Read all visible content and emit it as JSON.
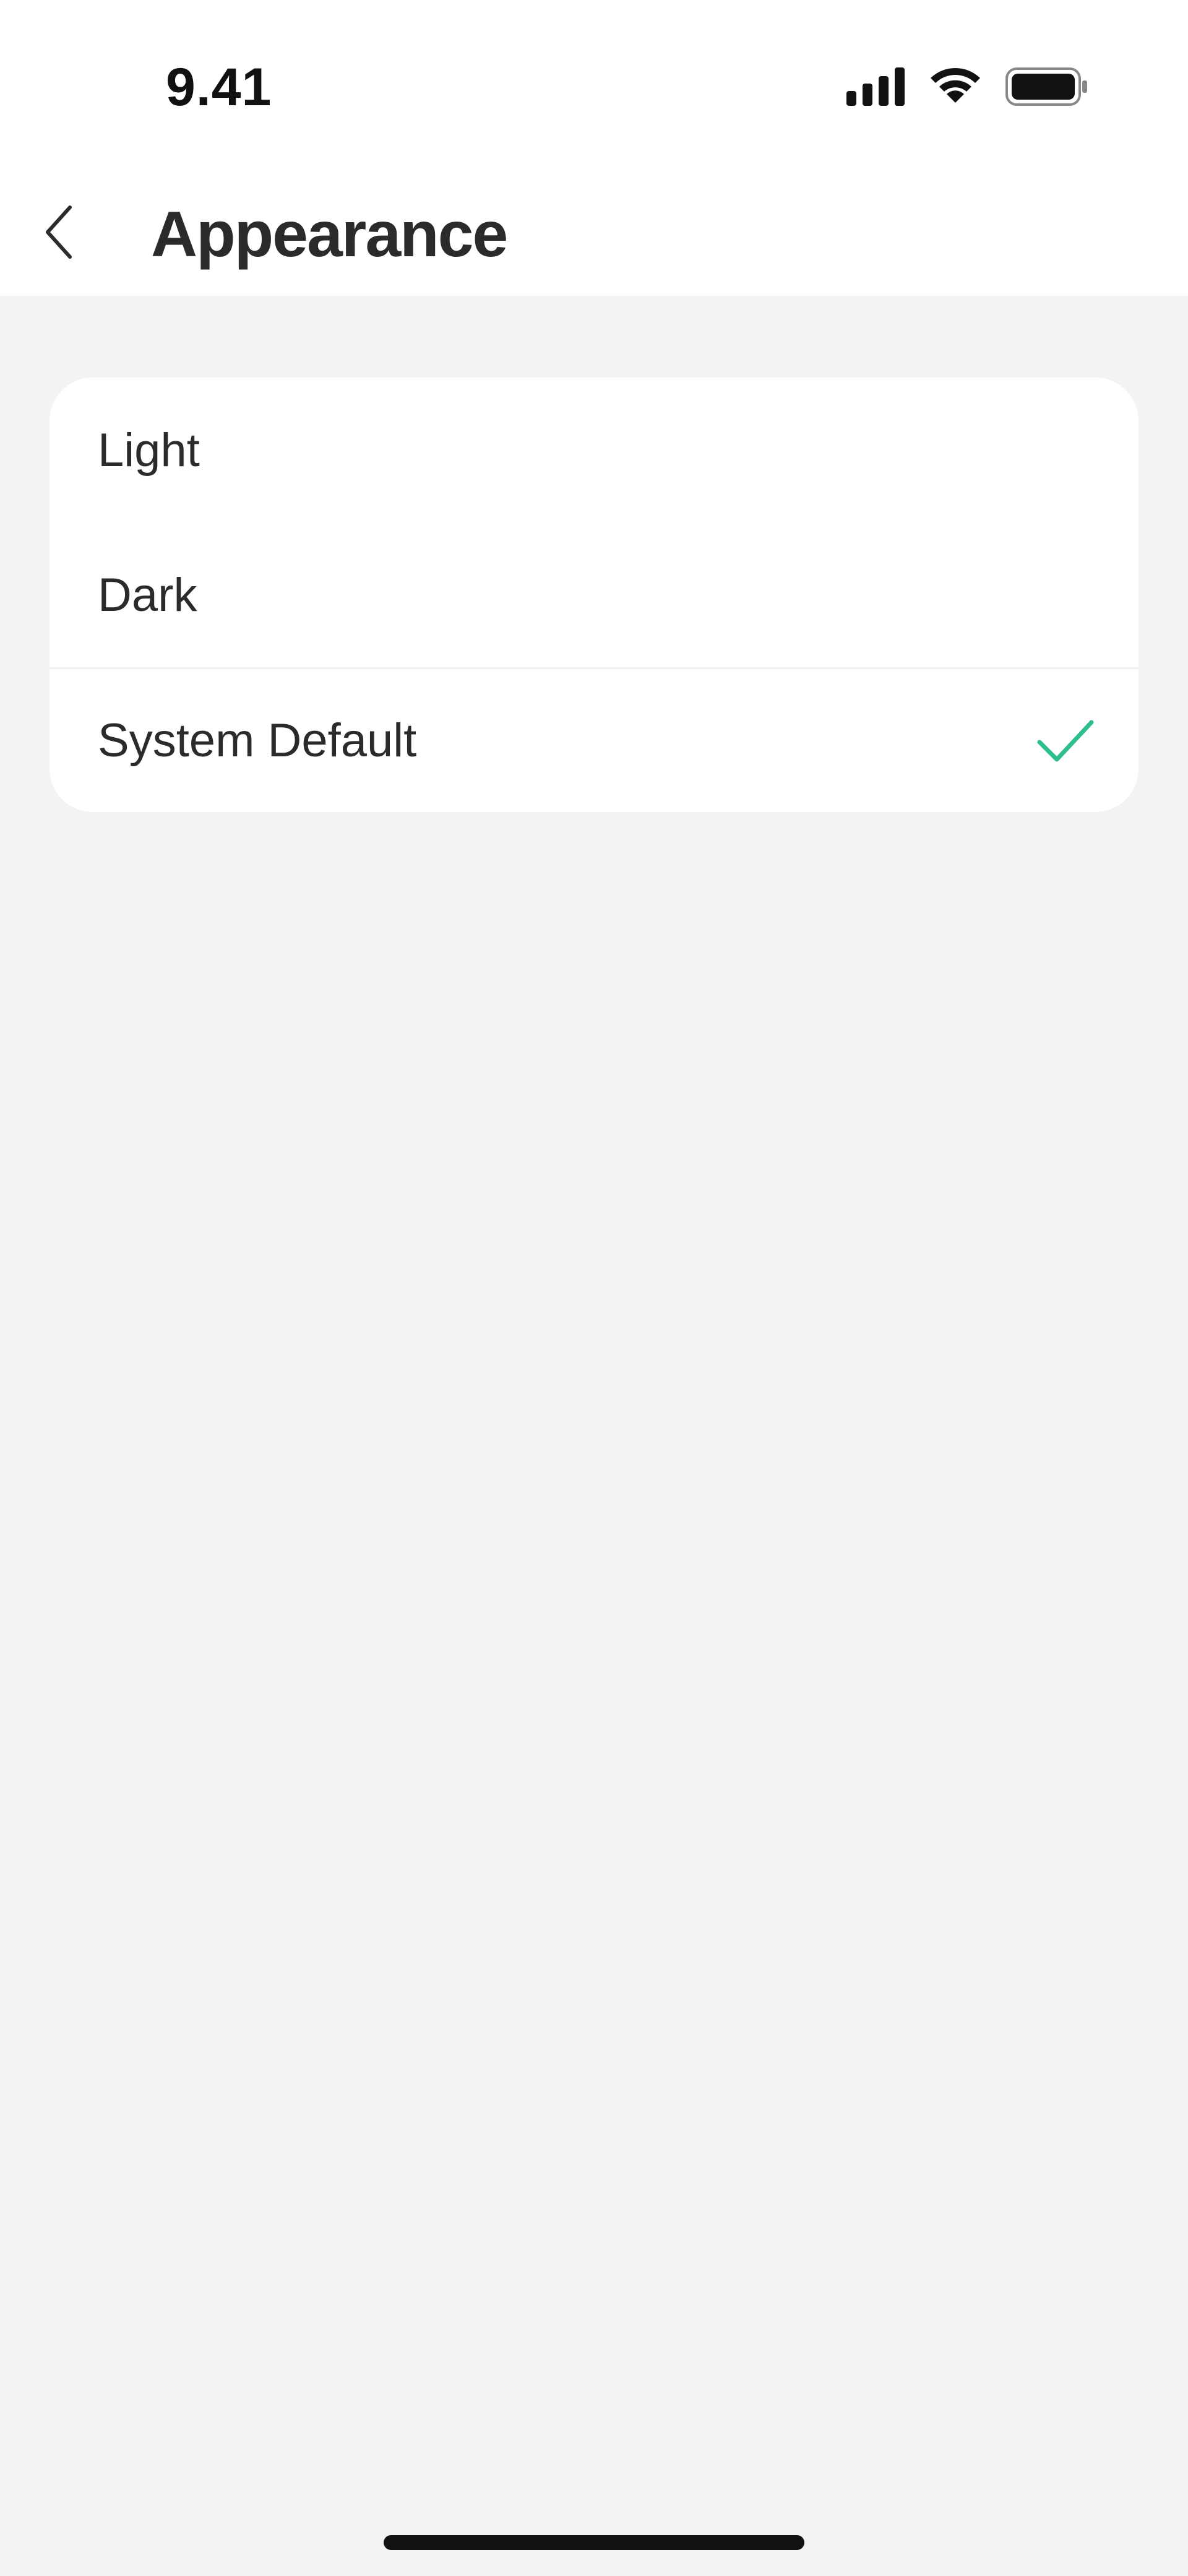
{
  "status_bar": {
    "time": "9.41",
    "icons": [
      "signal-icon",
      "wifi-icon",
      "battery-icon"
    ]
  },
  "header": {
    "back_icon": "chevron-left-icon",
    "title": "Appearance"
  },
  "options": [
    {
      "label": "Light",
      "selected": false
    },
    {
      "label": "Dark",
      "selected": false
    },
    {
      "label": "System Default",
      "selected": true
    }
  ],
  "colors": {
    "accent": "#2fbf8f",
    "background": "#f3f3f3",
    "surface": "#ffffff",
    "text": "#2b2b2b"
  }
}
